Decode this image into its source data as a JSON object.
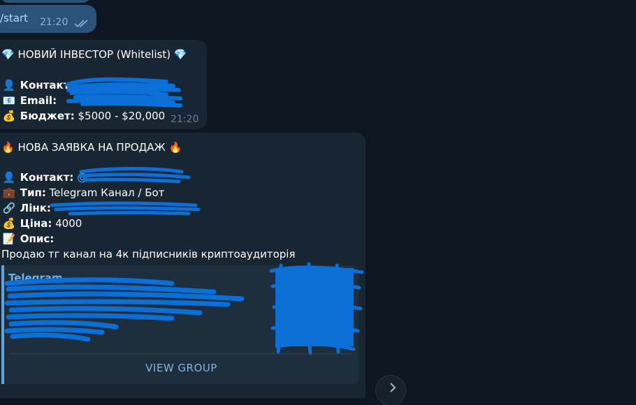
{
  "start_msg": {
    "text": "/start",
    "time": "21:20",
    "check_icon": "double-check-icon"
  },
  "investor_msg": {
    "title": "💎 НОВИЙ ІНВЕСТОР (Whitelist) 💎",
    "contact_label": "Контакт:",
    "email_label": "Email:",
    "budget_label": "Бюджет:",
    "budget_value": "$5000 - $20,000",
    "time": "21:20"
  },
  "sale_msg": {
    "title": "🔥 НОВА ЗАЯВКА НА ПРОДАЖ 🔥",
    "contact_label": "Контакт:",
    "contact_value": "@",
    "type_label": "Тип:",
    "type_value": "Telegram Канал / Бот",
    "link_label": "Лінк:",
    "price_label": "Ціна:",
    "price_value": "4000",
    "desc_label": "Опис:",
    "desc_value": "Продаю тг канал на 4к підписників криптоаудиторія",
    "preview": {
      "site": "Telegram",
      "button": "VIEW GROUP"
    }
  },
  "icons": {
    "contact": "👤",
    "email": "📧",
    "budget": "💰",
    "type": "💼",
    "link": "🔗",
    "price": "💰",
    "desc": "📝"
  },
  "colors": {
    "background": "#0e1621",
    "incoming": "#182533",
    "outgoing": "#2b5278",
    "scribble": "#0a6fd6"
  }
}
